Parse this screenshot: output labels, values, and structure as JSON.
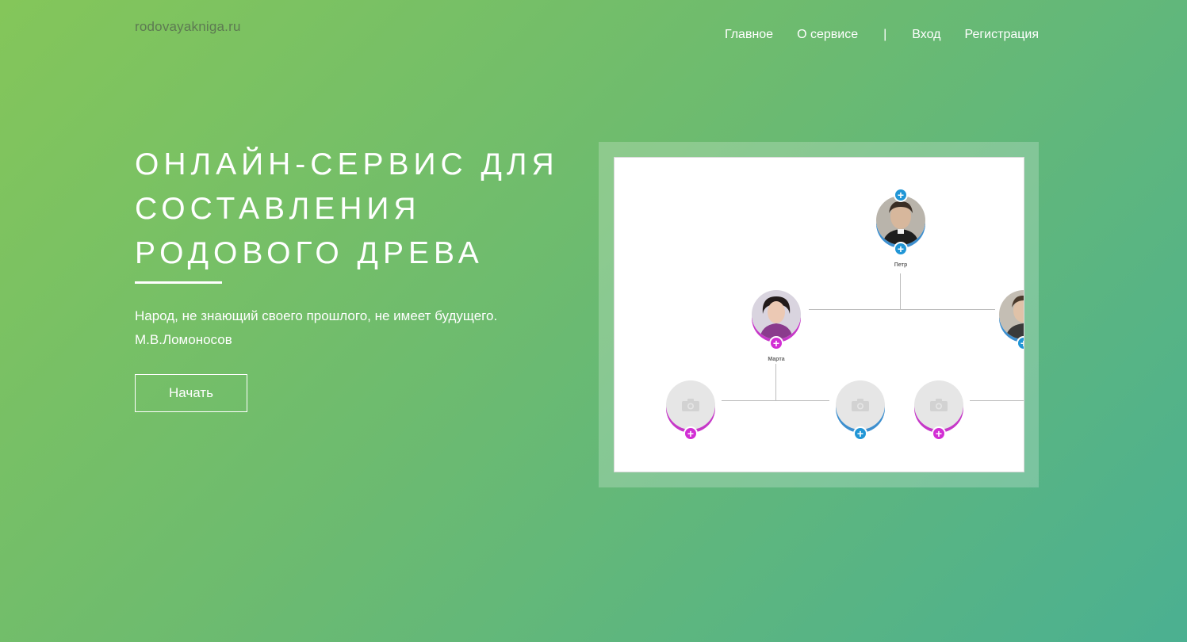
{
  "header": {
    "logo": "rodovayakniga.ru",
    "nav": {
      "home": "Главное",
      "about": "О сервисе",
      "separator": "|",
      "login": "Вход",
      "register": "Регистрация"
    }
  },
  "hero": {
    "title": "ОНЛАЙН-СЕРВИС ДЛЯ СОСТАВЛЕНИЯ РОДОВОГО ДРЕВА",
    "quote_line1": "Народ, не знающий своего прошлого, не имеет будущего.",
    "quote_line2": "М.В.Ломоносов",
    "start_button": "Начать"
  },
  "tree_preview": {
    "nodes": {
      "petr": "Петр",
      "marta": "Марта"
    },
    "colors": {
      "male_accent": "#2196d6",
      "female_accent": "#d22ed4"
    }
  }
}
